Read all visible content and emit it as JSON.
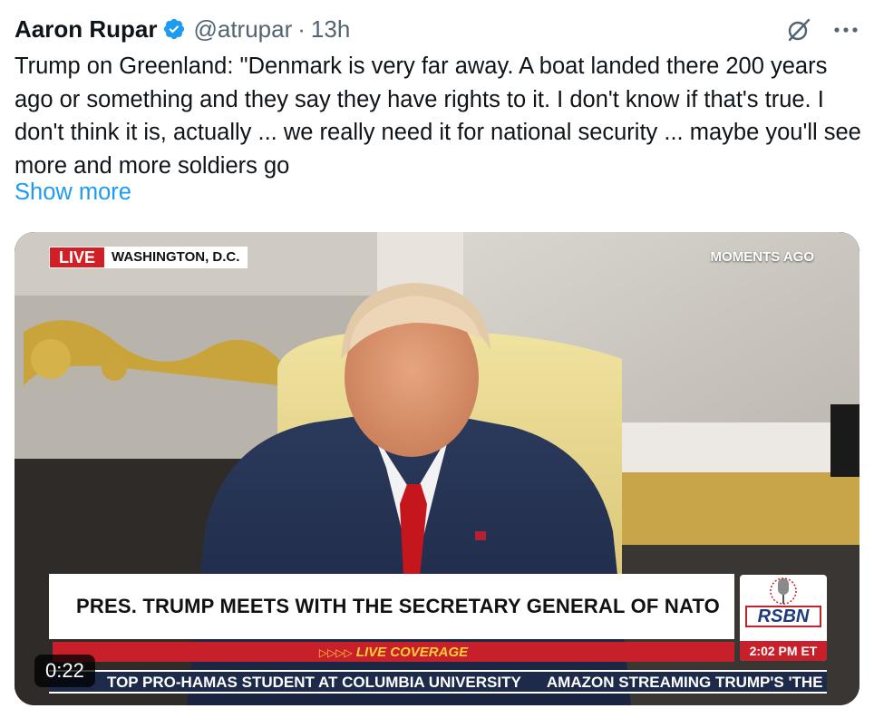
{
  "tweet": {
    "author_name": "Aaron Rupar",
    "handle": "@atrupar",
    "separator": "·",
    "time": "13h",
    "text": "Trump on Greenland: \"Denmark is very far away. A boat landed there 200 years ago or something and they say they have rights to it. I don't know if that's true. I don't think it is, actually ... we really need it for national security ... maybe you'll see more and more soldiers go",
    "show_more": "Show more",
    "icons": {
      "verified": "verified-badge-icon",
      "grok": "grok-icon",
      "more": "more-options-icon"
    },
    "colors": {
      "verified": "#1d9bf0",
      "link": "#1d9bf0",
      "secondary_text": "#536471"
    }
  },
  "video": {
    "live_label": "LIVE",
    "location": "WASHINGTON, D.C.",
    "moments": "MOMENTS AGO",
    "headline": "PRES. TRUMP MEETS WITH THE SECRETARY GENERAL OF NATO",
    "live_coverage": "LIVE COVERAGE",
    "live_coverage_arrows": "▷▷▷▷",
    "network": "RSBN",
    "network_time": "2:02 PM ET",
    "ticker": [
      "TOP PRO-HAMAS STUDENT AT COLUMBIA UNIVERSITY",
      "AMAZON STREAMING TRUMP'S 'THE A"
    ],
    "duration": "0:22",
    "colors": {
      "live_red": "#d21f26",
      "coverage_red": "#c8202a",
      "coverage_text": "#ffcf3a",
      "ticker_bg": "#1d2a4a"
    }
  }
}
